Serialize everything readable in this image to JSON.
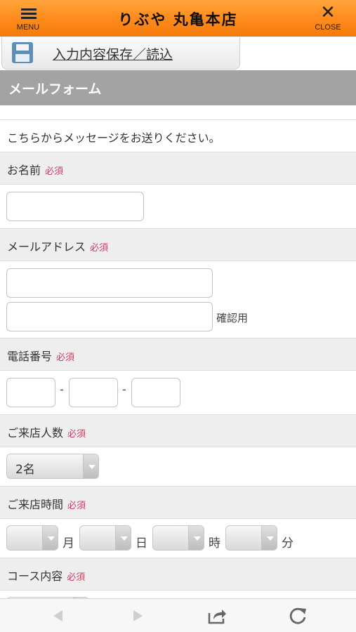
{
  "header": {
    "menu_label": "MENU",
    "close_label": "CLOSE",
    "shop_name": "りぶや 丸亀本店"
  },
  "save_tab": {
    "label": "入力内容保存／読込"
  },
  "form": {
    "title": "メールフォーム",
    "intro": "こちらからメッセージをお送りください。",
    "required_label": "必須",
    "name": {
      "label": "お名前",
      "value": ""
    },
    "email": {
      "label": "メールアドレス",
      "value": "",
      "confirm_value": "",
      "confirm_suffix": "確認用"
    },
    "phone": {
      "label": "電話番号",
      "part1": "",
      "part2": "",
      "part3": "",
      "separator": "-"
    },
    "party_size": {
      "label": "ご来店人数",
      "selected": "2名"
    },
    "visit_time": {
      "label": "ご来店時間",
      "month_unit": "月",
      "day_unit": "日",
      "hour_unit": "時",
      "minute_unit": "分",
      "month": "",
      "day": "",
      "hour": "",
      "minute": ""
    },
    "course": {
      "label": "コース内容"
    }
  },
  "browser": {
    "back_icon": "back-arrow-icon",
    "forward_icon": "forward-arrow-icon",
    "share_icon": "share-icon",
    "reload_icon": "reload-icon"
  }
}
